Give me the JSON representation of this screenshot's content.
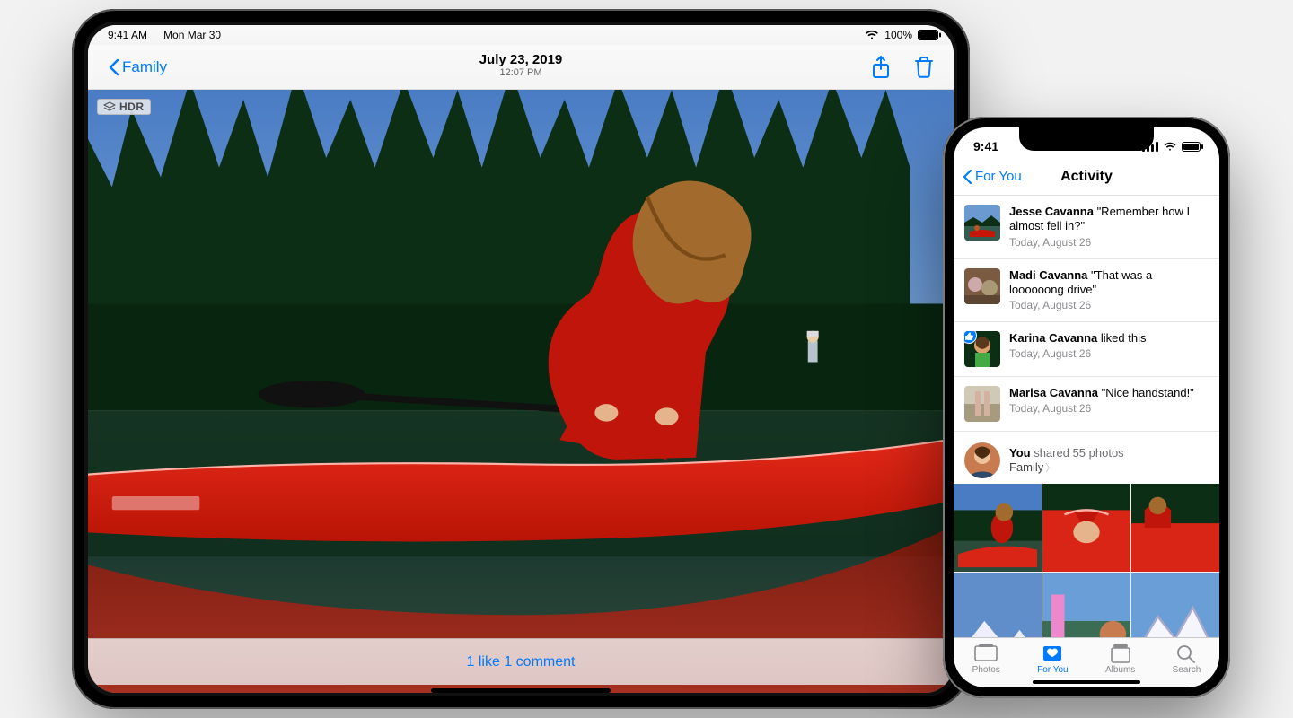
{
  "ipad": {
    "status": {
      "time": "9:41 AM",
      "date": "Mon Mar 30",
      "battery": "100%"
    },
    "back_label": "Family",
    "title_date": "July 23, 2019",
    "title_time": "12:07 PM",
    "hdr_badge": "HDR",
    "bottom_bar": "1 like 1 comment"
  },
  "iphone": {
    "status": {
      "time": "9:41"
    },
    "back_label": "For You",
    "title": "Activity",
    "items": [
      {
        "name": "Jesse Cavanna",
        "text": " \"Remember how I almost fell in?\"",
        "date": "Today, August 26"
      },
      {
        "name": "Madi Cavanna",
        "text": " \"That was a loooooong drive\"",
        "date": "Today, August 26"
      },
      {
        "name": "Karina Cavanna",
        "text": " liked this",
        "date": "Today, August 26",
        "liked": true
      },
      {
        "name": "Marisa Cavanna",
        "text": " \"Nice handstand!\"",
        "date": "Today, August 26"
      }
    ],
    "share": {
      "you": "You",
      "action": " shared 55 photos",
      "album": "Family"
    },
    "tabs": {
      "photos": "Photos",
      "for_you": "For You",
      "albums": "Albums",
      "search": "Search"
    }
  }
}
